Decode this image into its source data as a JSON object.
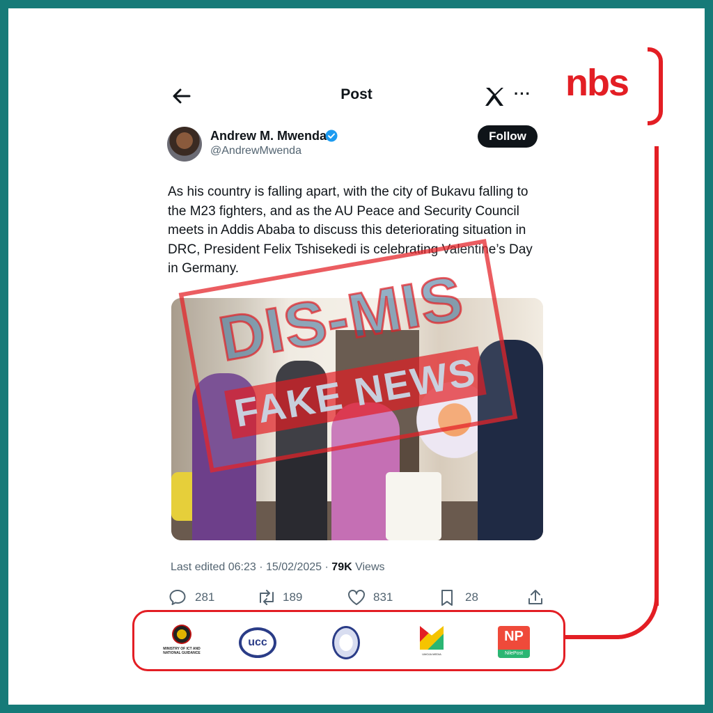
{
  "header": {
    "title": "Post",
    "back_icon": "arrow-left-icon",
    "x_icon": "x-logo-icon",
    "more_label": "···"
  },
  "brand": {
    "name": "nbs",
    "accent": "#e31e24",
    "frame": "#167a78"
  },
  "author": {
    "display_name": "Andrew M. Mwenda",
    "handle": "@AndrewMwenda",
    "verified_icon": "verified-badge-icon",
    "follow_label": "Follow"
  },
  "tweet": {
    "text": "As his country is falling apart, with the city of Bukavu falling to the M23 fighters, and as the AU Peace and Security Council meets in Addis Ababa to discuss this deteriorating situation in DRC, President Felix Tshisekedi is celebrating Valentine’s Day in Germany.",
    "stamp_top": "DIS-MIS",
    "stamp_bottom": "FAKE NEWS",
    "meta_prefix": "Last edited ",
    "meta_time": "06:23 · 15/02/2025",
    "meta_sep": " · ",
    "views_count": "79K",
    "views_label": " Views"
  },
  "actions": {
    "replies": "281",
    "reposts": "189",
    "likes": "831",
    "bookmarks": "28",
    "share_icon": "share-icon"
  },
  "sponsors": {
    "ministry_text": "MINISTRY OF ICT AND NATIONAL GUIDANCE",
    "ucc_text": "ucc",
    "m_text": "UMOJA MEDIA",
    "np_text": "NP",
    "np_sub": "NilePost"
  }
}
